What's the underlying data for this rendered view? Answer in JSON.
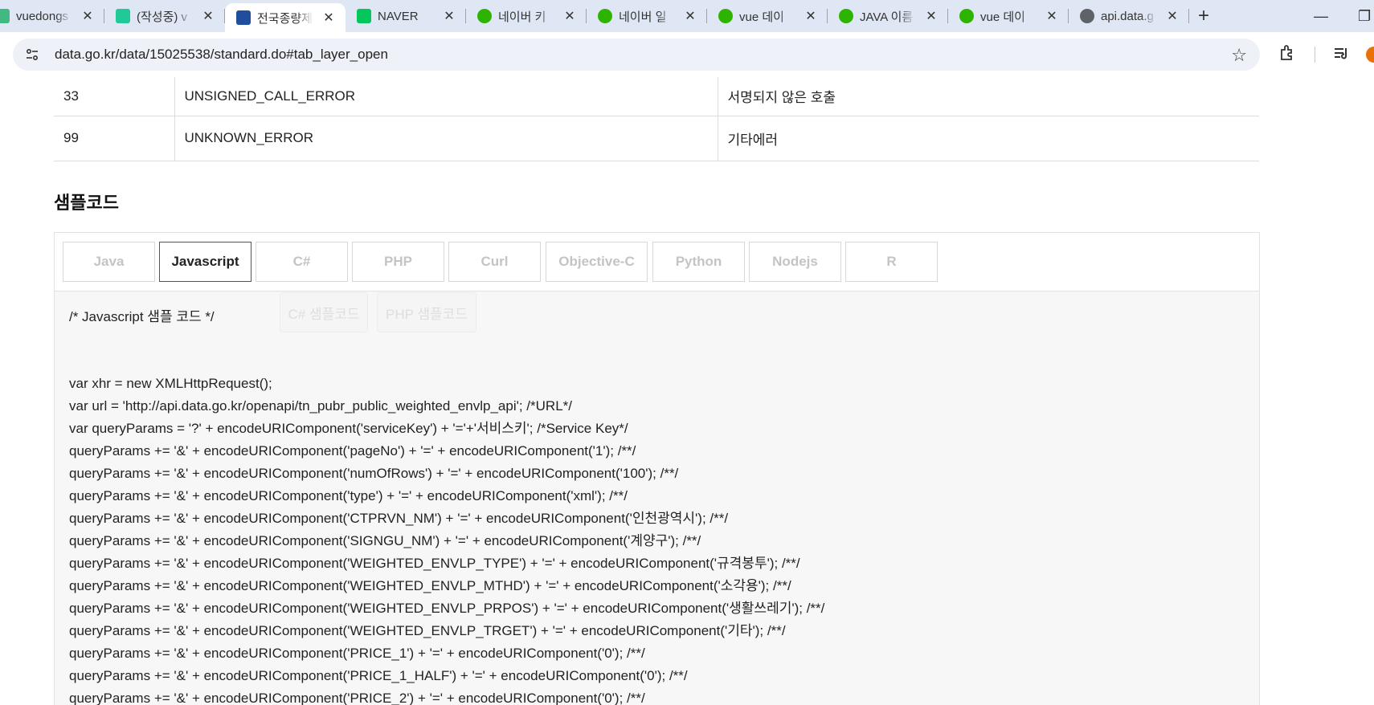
{
  "browser": {
    "tabs": [
      {
        "title": "vuedongs",
        "favicon": "v-icon",
        "fav_color": "#42b883",
        "active": false
      },
      {
        "title": "(작성중) v",
        "favicon": "velog-icon",
        "fav_color": "#20c997",
        "active": false
      },
      {
        "title": "전국종량제",
        "favicon": "data-go-kr-icon",
        "fav_color": "#1f4e9c",
        "active": true
      },
      {
        "title": "NAVER",
        "favicon": "naver-icon",
        "fav_color": "#03c75a",
        "active": false
      },
      {
        "title": "네이버 키",
        "favicon": "cup-icon",
        "fav_color": "#2db400",
        "active": false
      },
      {
        "title": "네이버 일",
        "favicon": "bell-icon",
        "fav_color": "#2db400",
        "active": false
      },
      {
        "title": "vue 데이",
        "favicon": "cup-icon",
        "fav_color": "#2db400",
        "active": false
      },
      {
        "title": "JAVA 이름",
        "favicon": "cup-icon",
        "fav_color": "#2db400",
        "active": false
      },
      {
        "title": "vue 데이",
        "favicon": "cup-icon",
        "fav_color": "#2db400",
        "active": false
      },
      {
        "title": "api.data.g",
        "favicon": "globe-icon",
        "fav_color": "#5f6368",
        "active": false
      }
    ],
    "new_tab_label": "+",
    "url": "data.go.kr/data/15025538/standard.do#tab_layer_open"
  },
  "error_table": {
    "rows": [
      {
        "code": "33",
        "name": "UNSIGNED_CALL_ERROR",
        "desc": "서명되지 않은 호출"
      },
      {
        "code": "99",
        "name": "UNKNOWN_ERROR",
        "desc": "기타에러"
      }
    ]
  },
  "sample": {
    "title": "샘플코드",
    "tabs": [
      {
        "label": "Java",
        "active": false
      },
      {
        "label": "Javascript",
        "active": true
      },
      {
        "label": "C#",
        "active": false
      },
      {
        "label": "PHP",
        "active": false
      },
      {
        "label": "Curl",
        "active": false
      },
      {
        "label": "Objective-C",
        "active": false
      },
      {
        "label": "Python",
        "active": false
      },
      {
        "label": "Nodejs",
        "active": false
      },
      {
        "label": "R",
        "active": false
      }
    ],
    "comment": "/* Javascript 샘플 코드 */",
    "ghost_buttons": [
      "C# 샘플코드",
      "PHP 샘플코드"
    ],
    "code_lines": [
      "var xhr = new XMLHttpRequest();",
      "var url = 'http://api.data.go.kr/openapi/tn_pubr_public_weighted_envlp_api'; /*URL*/",
      "var queryParams = '?' + encodeURIComponent('serviceKey') + '='+'서비스키'; /*Service Key*/",
      "queryParams += '&' + encodeURIComponent('pageNo') + '=' + encodeURIComponent('1'); /**/",
      "queryParams += '&' + encodeURIComponent('numOfRows') + '=' + encodeURIComponent('100'); /**/",
      "queryParams += '&' + encodeURIComponent('type') + '=' + encodeURIComponent('xml'); /**/",
      "queryParams += '&' + encodeURIComponent('CTPRVN_NM') + '=' + encodeURIComponent('인천광역시'); /**/",
      "queryParams += '&' + encodeURIComponent('SIGNGU_NM') + '=' + encodeURIComponent('계양구'); /**/",
      "queryParams += '&' + encodeURIComponent('WEIGHTED_ENVLP_TYPE') + '=' + encodeURIComponent('규격봉투'); /**/",
      "queryParams += '&' + encodeURIComponent('WEIGHTED_ENVLP_MTHD') + '=' + encodeURIComponent('소각용'); /**/",
      "queryParams += '&' + encodeURIComponent('WEIGHTED_ENVLP_PRPOS') + '=' + encodeURIComponent('생활쓰레기'); /**/",
      "queryParams += '&' + encodeURIComponent('WEIGHTED_ENVLP_TRGET') + '=' + encodeURIComponent('기타'); /**/",
      "queryParams += '&' + encodeURIComponent('PRICE_1') + '=' + encodeURIComponent('0'); /**/",
      "queryParams += '&' + encodeURIComponent('PRICE_1_HALF') + '=' + encodeURIComponent('0'); /**/",
      "queryParams += '&' + encodeURIComponent('PRICE_2') + '=' + encodeURIComponent('0'); /**/"
    ]
  },
  "colors": {
    "tabstrip_bg": "#dfe7f5",
    "omnibox_bg": "#eef1f7",
    "active_tab_border": "#555555",
    "inactive_tab_text": "#c4c4c4"
  }
}
